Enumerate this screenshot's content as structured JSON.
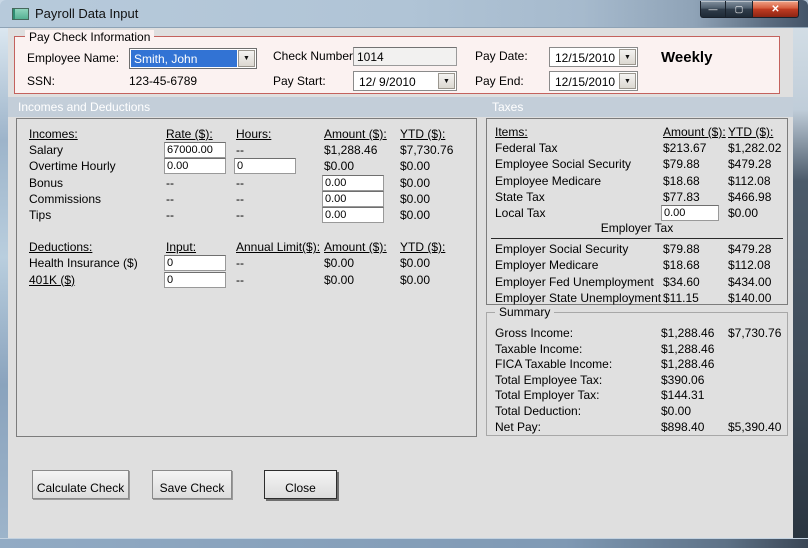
{
  "window": {
    "title": "Payroll Data Input",
    "controls": [
      {
        "name": "minimize",
        "glyph": "—"
      },
      {
        "name": "maximize",
        "glyph": "▢"
      },
      {
        "name": "close",
        "glyph": "✕"
      }
    ]
  },
  "paycheck": {
    "group_label": "Pay Check Information",
    "employee_name_label": "Employee Name:",
    "employee_name_value": "Smith, John",
    "ssn_label": "SSN:",
    "ssn_value": "123-45-6789",
    "check_number_label": "Check Number:",
    "check_number_value": "1014",
    "pay_start_label": "Pay Start:",
    "pay_start_value": "12/ 9/2010",
    "pay_date_label": "Pay Date:",
    "pay_date_value": "12/15/2010",
    "pay_end_label": "Pay End:",
    "pay_end_value": "12/15/2010",
    "frequency": "Weekly",
    "dropdown_glyph": "▼"
  },
  "sections": {
    "left": "Incomes and Deductions",
    "right": "Taxes"
  },
  "incomes": {
    "headers": {
      "item": "Incomes:",
      "rate": "Rate ($):",
      "hours": "Hours:",
      "amount": "Amount ($):",
      "ytd": "YTD ($):"
    },
    "rows": [
      {
        "label": "Salary",
        "rate": "67000.00",
        "hours": "--",
        "amount": "$1,288.46",
        "ytd": "$7,730.76"
      },
      {
        "label": "Overtime Hourly",
        "rate": "0.00",
        "hours": "0",
        "amount": "$0.00",
        "ytd": "$0.00"
      },
      {
        "label": "Bonus",
        "rate": "--",
        "hours": "--",
        "amount": "0.00",
        "ytd": "$0.00"
      },
      {
        "label": "Commissions",
        "rate": "--",
        "hours": "--",
        "amount": "0.00",
        "ytd": "$0.00"
      },
      {
        "label": "Tips",
        "rate": "--",
        "hours": "--",
        "amount": "0.00",
        "ytd": "$0.00"
      }
    ]
  },
  "deductions": {
    "headers": {
      "item": "Deductions:",
      "input": "Input:",
      "limit": "Annual Limit($):",
      "amount": "Amount ($):",
      "ytd": "YTD ($):"
    },
    "rows": [
      {
        "label": "Health Insurance  ($)",
        "input": "0",
        "limit": "--",
        "amount": "$0.00",
        "ytd": "$0.00"
      },
      {
        "label": "401K  ($)",
        "input": "0",
        "limit": "--",
        "amount": "$0.00",
        "ytd": "$0.00"
      }
    ]
  },
  "taxes": {
    "headers": {
      "item": "Items:",
      "amount": "Amount ($):",
      "ytd": "YTD ($):"
    },
    "employee_rows": [
      {
        "label": "Federal Tax",
        "amount": "$213.67",
        "ytd": "$1,282.02"
      },
      {
        "label": "Employee Social Security",
        "amount": "$79.88",
        "ytd": "$479.28"
      },
      {
        "label": "Employee Medicare",
        "amount": "$18.68",
        "ytd": "$112.08"
      },
      {
        "label": "State Tax",
        "amount": "$77.83",
        "ytd": "$466.98"
      },
      {
        "label": "Local Tax",
        "amount": "0.00",
        "ytd": "$0.00"
      }
    ],
    "employer_header": "Employer Tax",
    "employer_rows": [
      {
        "label": "Employer Social Security",
        "amount": "$79.88",
        "ytd": "$479.28"
      },
      {
        "label": "Employer Medicare",
        "amount": "$18.68",
        "ytd": "$112.08"
      },
      {
        "label": "Employer Fed Unemployment",
        "amount": "$34.60",
        "ytd": "$434.00"
      },
      {
        "label": "Employer State Unemployment",
        "amount": "$11.15",
        "ytd": "$140.00"
      }
    ]
  },
  "summary": {
    "group_label": "Summary",
    "rows": [
      {
        "label": "Gross Income:",
        "amount": "$1,288.46",
        "ytd": "$7,730.76"
      },
      {
        "label": "Taxable Income:",
        "amount": "$1,288.46",
        "ytd": ""
      },
      {
        "label": "FICA Taxable Income:",
        "amount": "$1,288.46",
        "ytd": ""
      },
      {
        "label": "Total Employee Tax:",
        "amount": "$390.06",
        "ytd": ""
      },
      {
        "label": "Total Employer Tax:",
        "amount": "$144.31",
        "ytd": ""
      },
      {
        "label": "Total Deduction:",
        "amount": "$0.00",
        "ytd": ""
      },
      {
        "label": "Net Pay:",
        "amount": "$898.40",
        "ytd": "$5,390.40"
      }
    ]
  },
  "buttons": {
    "calculate": "Calculate Check",
    "save": "Save Check",
    "close": "Close"
  },
  "colors": {
    "group_border": "#c4625d",
    "section_band": "#c3ced9",
    "selection_blue": "#3273d4",
    "close_red": "#c13c22"
  }
}
